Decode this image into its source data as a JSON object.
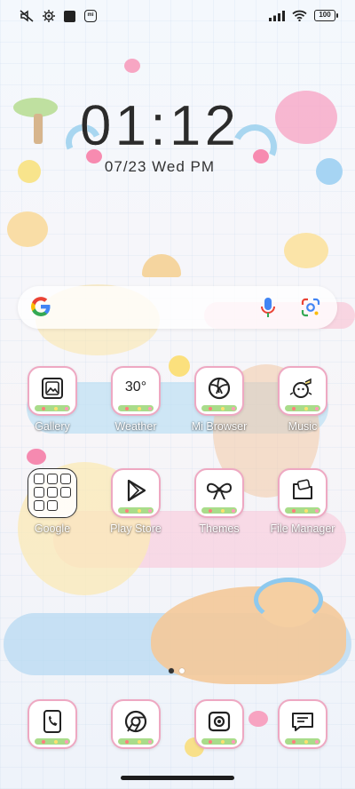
{
  "status_bar": {
    "left_icons": [
      "mute-icon",
      "settings-icon",
      "notification-icon",
      "mi-icon"
    ],
    "right_icons": [
      "signal-icon",
      "wifi-icon"
    ],
    "battery_level": "100"
  },
  "clock": {
    "time": "01:12",
    "date": "07/23 Wed PM"
  },
  "search": {
    "logo": "google-logo",
    "mic": "microphone-icon",
    "lens": "google-lens-icon"
  },
  "apps": [
    {
      "label": "Gallery",
      "icon": "gallery-icon"
    },
    {
      "label": "Weather",
      "icon": "weather-icon",
      "value": "30°"
    },
    {
      "label": "Mi Browser",
      "icon": "browser-icon"
    },
    {
      "label": "Music",
      "icon": "music-icon"
    },
    {
      "label": "Google",
      "icon": "folder-icon"
    },
    {
      "label": "Play Store",
      "icon": "play-store-icon"
    },
    {
      "label": "Themes",
      "icon": "themes-icon"
    },
    {
      "label": "File Manager",
      "icon": "file-manager-icon"
    }
  ],
  "dock": [
    {
      "icon": "phone-icon"
    },
    {
      "icon": "chrome-icon"
    },
    {
      "icon": "camera-icon"
    },
    {
      "icon": "messages-icon"
    }
  ],
  "page_indicator": {
    "pages": 2,
    "active": 1
  },
  "colors": {
    "tile_border": "#eea8c2",
    "accent_pink": "#f7b8cd",
    "accent_blue": "#a8d3ef",
    "accent_yellow": "#f6e3a0"
  }
}
